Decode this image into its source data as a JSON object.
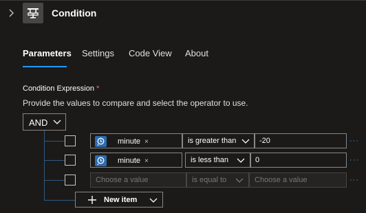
{
  "header": {
    "title": "Condition",
    "expand_icon": "chevron-right-icon",
    "action_icon": "condition-icon"
  },
  "tabs": [
    {
      "label": "Parameters",
      "active": true
    },
    {
      "label": "Settings",
      "active": false
    },
    {
      "label": "Code View",
      "active": false
    },
    {
      "label": "About",
      "active": false
    }
  ],
  "expression": {
    "label": "Condition Expression",
    "required_mark": "*",
    "description": "Provide the values to compare and select the operator to use.",
    "group_operator": "AND",
    "rows": [
      {
        "left_token": "minute",
        "token_remove": "×",
        "operator": "is greater than",
        "right_value": "-20",
        "more": "···"
      },
      {
        "left_token": "minute",
        "token_remove": "×",
        "operator": "is less than",
        "right_value": "0",
        "more": "···"
      },
      {
        "left_placeholder": "Choose a value",
        "operator": "is equal to",
        "right_placeholder": "Choose a value",
        "more": "···"
      }
    ],
    "new_item_label": "New item"
  },
  "colors": {
    "accent": "#2899f5",
    "background": "#1b1a19",
    "required": "#f1707b",
    "token": "#2b6cb0"
  }
}
